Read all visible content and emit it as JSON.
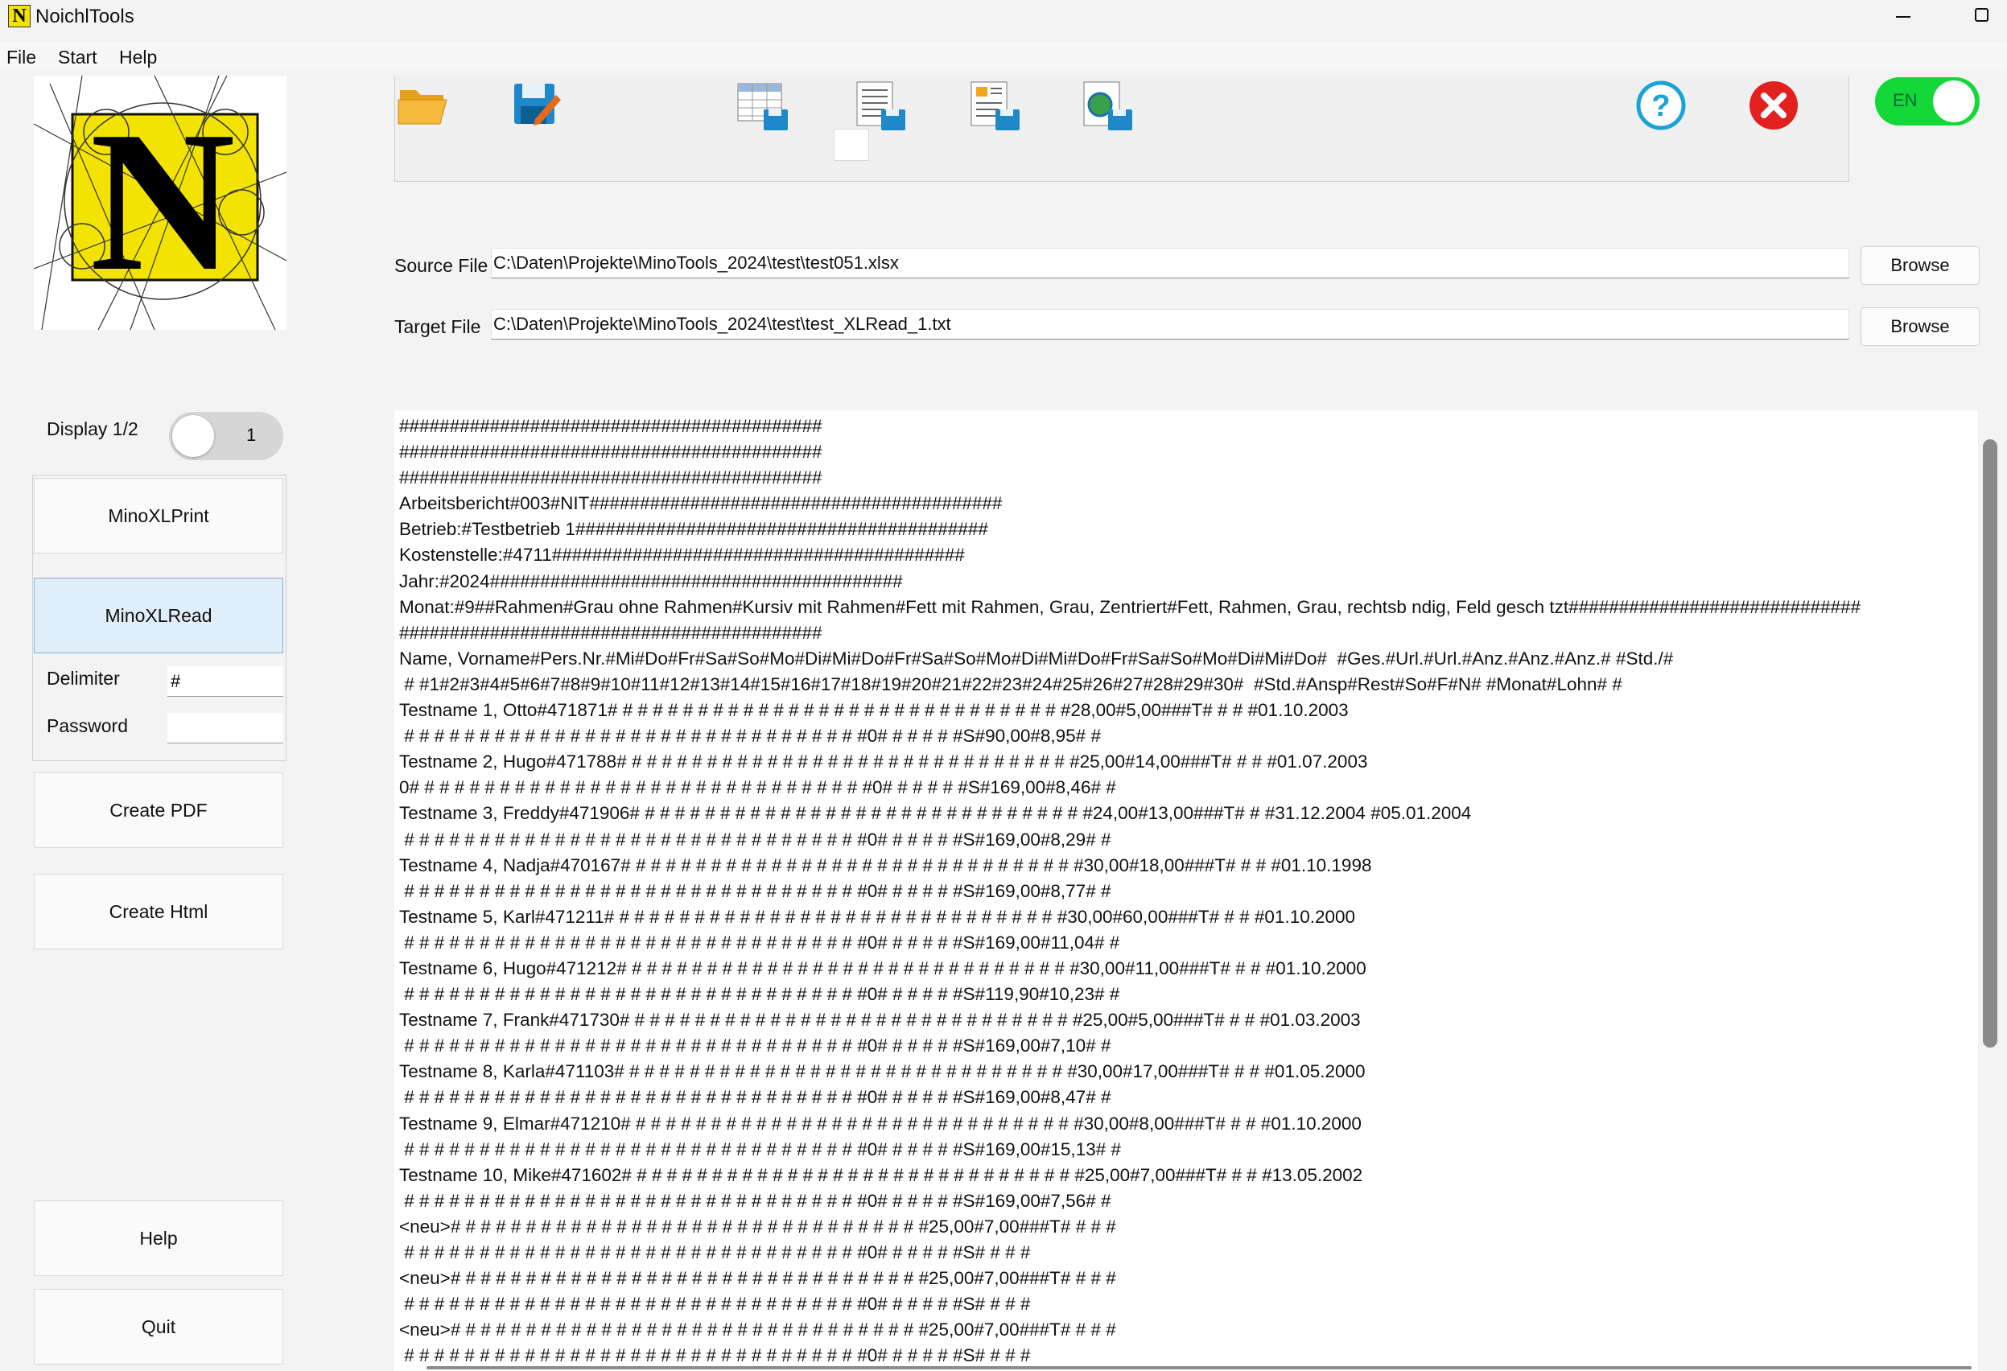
{
  "window": {
    "title": "NoichlTools",
    "icon_letter": "N"
  },
  "menu": [
    "File",
    "Start",
    "Help"
  ],
  "sidebar": {
    "display_label": "Display 1/2",
    "display_value": "1",
    "buttons": {
      "minoxlprint": "MinoXLPrint",
      "minoxlread": "MinoXLRead",
      "create_pdf": "Create PDF",
      "create_html": "Create Html",
      "help": "Help",
      "quit": "Quit"
    },
    "delimiter_label": "Delimiter",
    "delimiter_value": "#",
    "password_label": "Password",
    "password_value": ""
  },
  "toolbar": {
    "icons": [
      "folder-open-icon",
      "save-edit-icon",
      "save-table-icon",
      "save-document-icon",
      "save-layout-icon",
      "save-web-icon",
      "help-icon",
      "close-icon"
    ],
    "language": "EN"
  },
  "files": {
    "source_label": "Source File",
    "source_value": "C:\\Daten\\Projekte\\MinoTools_2024\\test\\test051.xlsx",
    "target_label": "Target File",
    "target_value": "C:\\Daten\\Projekte\\MinoTools_2024\\test\\test_XLRead_1.txt",
    "browse_label": "Browse"
  },
  "colors": {
    "lang_toggle": "#13d838",
    "active_button": "#e0eef9",
    "logo_yellow": "#f2e400",
    "help_blue": "#1aa3d8",
    "close_red": "#e32020"
  },
  "output_lines": [
    "##########################################",
    "##########################################",
    "##########################################",
    "Arbeitsbericht#003#NIT#########################################",
    "Betrieb:#Testbetrieb 1#########################################",
    "Kostenstelle:#4711#########################################",
    "Jahr:#2024#########################################",
    "Monat:#9##Rahmen#Grau ohne Rahmen#Kursiv mit Rahmen#Fett mit Rahmen, Grau, Zentriert#Fett, Rahmen, Grau, rechtsb ndig, Feld gesch tzt#############################",
    "##########################################",
    "Name, Vorname#Pers.Nr.#Mi#Do#Fr#Sa#So#Mo#Di#Mi#Do#Fr#Sa#So#Mo#Di#Mi#Do#Fr#Sa#So#Mo#Di#Mi#Do#  #Ges.#Url.#Url.#Anz.#Anz.#Anz.# #Std./#",
    " # #1#2#3#4#5#6#7#8#9#10#11#12#13#14#15#16#17#18#19#20#21#22#23#24#25#26#27#28#29#30#  #Std.#Ansp#Rest#So#F#N# #Monat#Lohn# #",
    "Testname 1, Otto#471871# # # # # # # # # # # # # # # # # # # # # # # # # # # # # # #28,00#5,00###T# # # #01.10.2003",
    " # # # # # # # # # # # # # # # # # # # # # # # # # # # # # # #0# # # # # #S#90,00#8,95# #",
    "Testname 2, Hugo#471788# # # # # # # # # # # # # # # # # # # # # # # # # # # # # # #25,00#14,00###T# # # #01.07.2003",
    "0# # # # # # # # # # # # # # # # # # # # # # # # # # # # # # #0# # # # # #S#169,00#8,46# #",
    "Testname 3, Freddy#471906# # # # # # # # # # # # # # # # # # # # # # # # # # # # # # #24,00#13,00###T# # #31.12.2004 #05.01.2004",
    " # # # # # # # # # # # # # # # # # # # # # # # # # # # # # # #0# # # # # #S#169,00#8,29# #",
    "Testname 4, Nadja#470167# # # # # # # # # # # # # # # # # # # # # # # # # # # # # # #30,00#18,00###T# # # #01.10.1998",
    " # # # # # # # # # # # # # # # # # # # # # # # # # # # # # # #0# # # # # #S#169,00#8,77# #",
    "Testname 5, Karl#471211# # # # # # # # # # # # # # # # # # # # # # # # # # # # # # #30,00#60,00###T# # # #01.10.2000",
    " # # # # # # # # # # # # # # # # # # # # # # # # # # # # # # #0# # # # # #S#169,00#11,04# #",
    "Testname 6, Hugo#471212# # # # # # # # # # # # # # # # # # # # # # # # # # # # # # #30,00#11,00###T# # # #01.10.2000",
    " # # # # # # # # # # # # # # # # # # # # # # # # # # # # # # #0# # # # # #S#119,90#10,23# #",
    "Testname 7, Frank#471730# # # # # # # # # # # # # # # # # # # # # # # # # # # # # # #25,00#5,00###T# # # #01.03.2003",
    " # # # # # # # # # # # # # # # # # # # # # # # # # # # # # # #0# # # # # #S#169,00#7,10# #",
    "Testname 8, Karla#471103# # # # # # # # # # # # # # # # # # # # # # # # # # # # # # #30,00#17,00###T# # # #01.05.2000",
    " # # # # # # # # # # # # # # # # # # # # # # # # # # # # # # #0# # # # # #S#169,00#8,47# #",
    "Testname 9, Elmar#471210# # # # # # # # # # # # # # # # # # # # # # # # # # # # # # #30,00#8,00###T# # # #01.10.2000",
    " # # # # # # # # # # # # # # # # # # # # # # # # # # # # # # #0# # # # # #S#169,00#15,13# #",
    "Testname 10, Mike#471602# # # # # # # # # # # # # # # # # # # # # # # # # # # # # # #25,00#7,00###T# # # #13.05.2002",
    " # # # # # # # # # # # # # # # # # # # # # # # # # # # # # # #0# # # # # #S#169,00#7,56# #",
    "<neu># # # # # # # # # # # # # # # # # # # # # # # # # # # # # # # #25,00#7,00###T# # # #",
    " # # # # # # # # # # # # # # # # # # # # # # # # # # # # # # #0# # # # # #S# # # #",
    "<neu># # # # # # # # # # # # # # # # # # # # # # # # # # # # # # # #25,00#7,00###T# # # #",
    " # # # # # # # # # # # # # # # # # # # # # # # # # # # # # # #0# # # # # #S# # # #",
    "<neu># # # # # # # # # # # # # # # # # # # # # # # # # # # # # # # #25,00#7,00###T# # # #",
    " # # # # # # # # # # # # # # # # # # # # # # # # # # # # # # #0# # # # # #S# # # #"
  ]
}
